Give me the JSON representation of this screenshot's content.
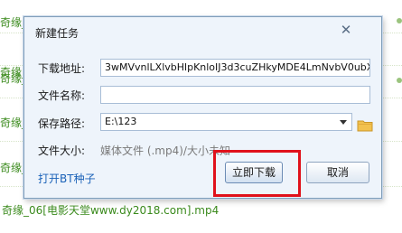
{
  "background_list": {
    "items": [
      {
        "text": "奇缘_0"
      },
      {
        "text": "奇缘_0"
      },
      {
        "text": "奇缘_0"
      },
      {
        "text": "奇缘_0"
      },
      {
        "text": "奇缘_0"
      },
      {
        "text": "奇缘_06[电影天堂www.dy2018.com].mp4"
      }
    ]
  },
  "dialog": {
    "title": "新建任务",
    "close_glyph": "✕",
    "url_label": "下载地址:",
    "url_value": "3wMVvnlLXlvbHlpKnloIJ3d3cuZHkyMDE4LmNvbV0ubXA0Wlo=",
    "filename_label": "文件名称:",
    "filename_value": "",
    "path_label": "保存路径:",
    "path_value": "E:\\123",
    "size_label": "文件大小:",
    "size_value": "媒体文件 (.mp4)/大小未知",
    "bt_link": "打开BT种子",
    "download_button": "立即下载",
    "cancel_button": "取消"
  },
  "colors": {
    "highlight": "#e0111b",
    "link": "#1b62b8",
    "list_text": "#3a8a1c"
  },
  "icons": {
    "close": "close-icon",
    "folder": "folder-icon",
    "dropdown": "chevron-down-icon"
  }
}
